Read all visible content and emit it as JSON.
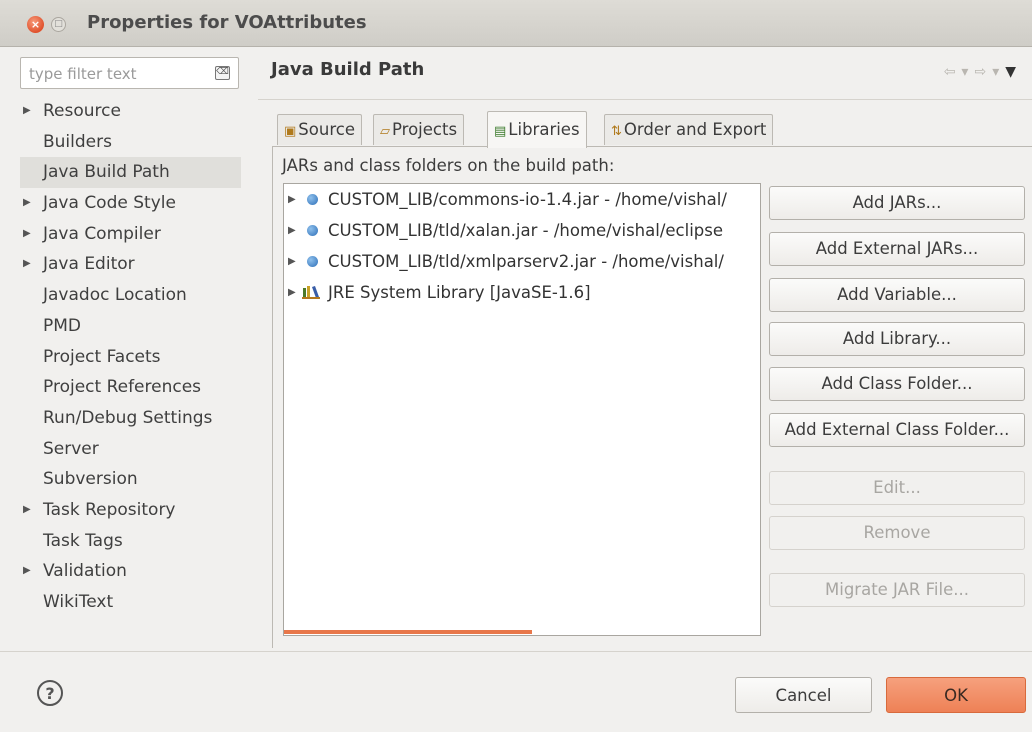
{
  "window": {
    "title": "Properties for VOAttributes",
    "close_glyph": "×",
    "min_glyph": "□"
  },
  "filter": {
    "placeholder": "type filter text",
    "clear_glyph": "⌫"
  },
  "nav": {
    "items": [
      {
        "label": "Resource",
        "expandable": true
      },
      {
        "label": "Builders",
        "expandable": false
      },
      {
        "label": "Java Build Path",
        "expandable": false,
        "selected": true
      },
      {
        "label": "Java Code Style",
        "expandable": true
      },
      {
        "label": "Java Compiler",
        "expandable": true
      },
      {
        "label": "Java Editor",
        "expandable": true
      },
      {
        "label": "Javadoc Location",
        "expandable": false
      },
      {
        "label": "PMD",
        "expandable": false
      },
      {
        "label": "Project Facets",
        "expandable": false
      },
      {
        "label": "Project References",
        "expandable": false
      },
      {
        "label": "Run/Debug Settings",
        "expandable": false
      },
      {
        "label": "Server",
        "expandable": false
      },
      {
        "label": "Subversion",
        "expandable": false
      },
      {
        "label": "Task Repository",
        "expandable": true
      },
      {
        "label": "Task Tags",
        "expandable": false
      },
      {
        "label": "Validation",
        "expandable": true
      },
      {
        "label": "WikiText",
        "expandable": false
      }
    ]
  },
  "page": {
    "title": "Java Build Path"
  },
  "tabs": [
    {
      "label": "Source",
      "icon": "source-folder-icon",
      "active": false
    },
    {
      "label": "Projects",
      "icon": "projects-icon",
      "active": false
    },
    {
      "label": "Libraries",
      "icon": "libraries-icon",
      "active": true
    },
    {
      "label": "Order and Export",
      "icon": "order-export-icon",
      "active": false
    }
  ],
  "libraries": {
    "label": "JARs and class folders on the build path:",
    "entries": [
      {
        "text": "CUSTOM_LIB/commons-io-1.4.jar - /home/vishal/",
        "icon": "jar-variable-icon"
      },
      {
        "text": "CUSTOM_LIB/tld/xalan.jar - /home/vishal/eclipse",
        "icon": "jar-variable-icon"
      },
      {
        "text": "CUSTOM_LIB/tld/xmlparserv2.jar - /home/vishal/",
        "icon": "jar-variable-icon"
      },
      {
        "text": "JRE System Library [JavaSE-1.6]",
        "icon": "library-icon"
      }
    ]
  },
  "buttons": {
    "add_jars": "Add JARs...",
    "add_external_jars": "Add External JARs...",
    "add_variable": "Add Variable...",
    "add_library": "Add Library...",
    "add_class_folder": "Add Class Folder...",
    "add_external_class_folder": "Add External Class Folder...",
    "edit": "Edit...",
    "remove": "Remove",
    "migrate_jar": "Migrate JAR File..."
  },
  "footer": {
    "help_glyph": "?",
    "cancel": "Cancel",
    "ok": "OK"
  },
  "colors": {
    "accent": "#ee8156",
    "selection": "#e0dfdb",
    "scroll": "#e8774a"
  }
}
